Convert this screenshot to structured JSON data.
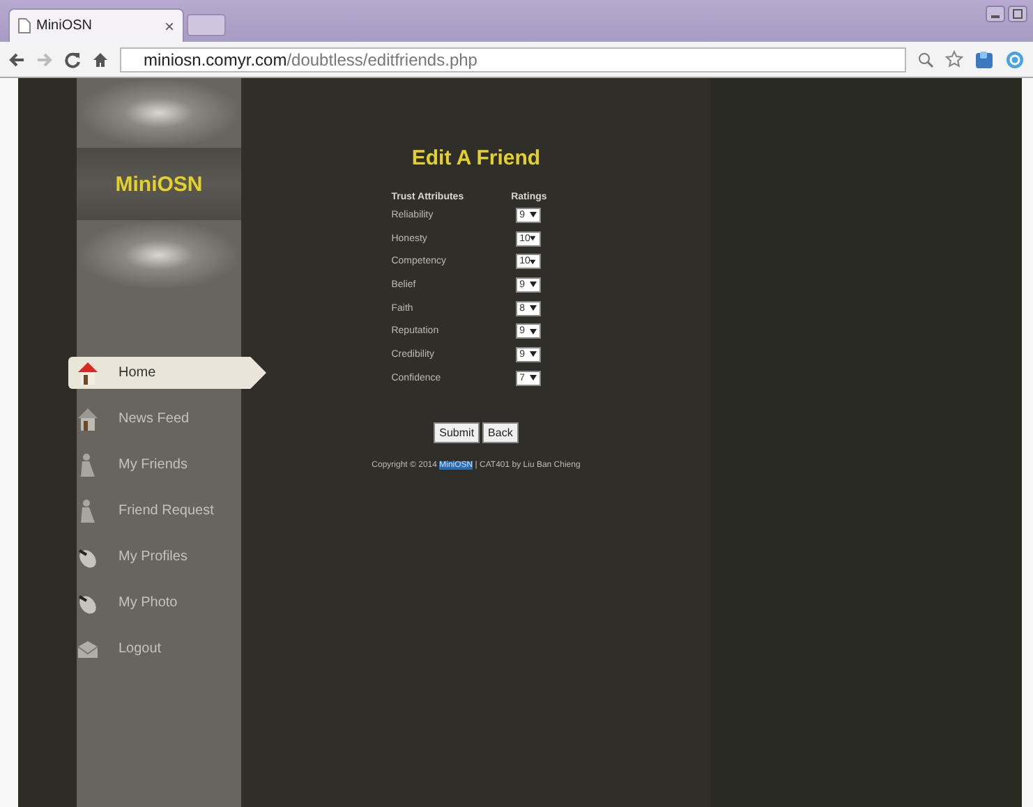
{
  "browser": {
    "tab_title": "MiniOSN",
    "tab_close": "×",
    "url_host": "miniosn.comyr.com",
    "url_path": "/doubtless/editfriends.php"
  },
  "sidebar": {
    "logo": "MiniOSN",
    "items": [
      {
        "label": "Home",
        "kind": "house",
        "selected": true
      },
      {
        "label": "News Feed",
        "kind": "house",
        "selected": false
      },
      {
        "label": "My Friends",
        "kind": "person",
        "selected": false
      },
      {
        "label": "Friend Request",
        "kind": "person",
        "selected": false
      },
      {
        "label": "My Profiles",
        "kind": "mouse",
        "selected": false
      },
      {
        "label": "My Photo",
        "kind": "mouse",
        "selected": false
      },
      {
        "label": "Logout",
        "kind": "envelope",
        "selected": false
      }
    ]
  },
  "title": "Edit A Friend",
  "table": {
    "columns": [
      "Trust Attributes",
      "Ratings"
    ],
    "rows": [
      {
        "attribute": "Reliability",
        "rating": "9"
      },
      {
        "attribute": "Honesty",
        "rating": "10"
      },
      {
        "attribute": "Competency",
        "rating": "10"
      },
      {
        "attribute": "Belief",
        "rating": "9"
      },
      {
        "attribute": "Faith",
        "rating": "8"
      },
      {
        "attribute": "Reputation",
        "rating": "9"
      },
      {
        "attribute": "Credibility",
        "rating": "9"
      },
      {
        "attribute": "Confidence",
        "rating": "7"
      }
    ]
  },
  "buttons": [
    "Submit",
    "Back"
  ],
  "footer": {
    "before": "Copyright © 2014 ",
    "link": "MiniOSN",
    "after": " | CAT401 by Liu Ban Chieng"
  }
}
